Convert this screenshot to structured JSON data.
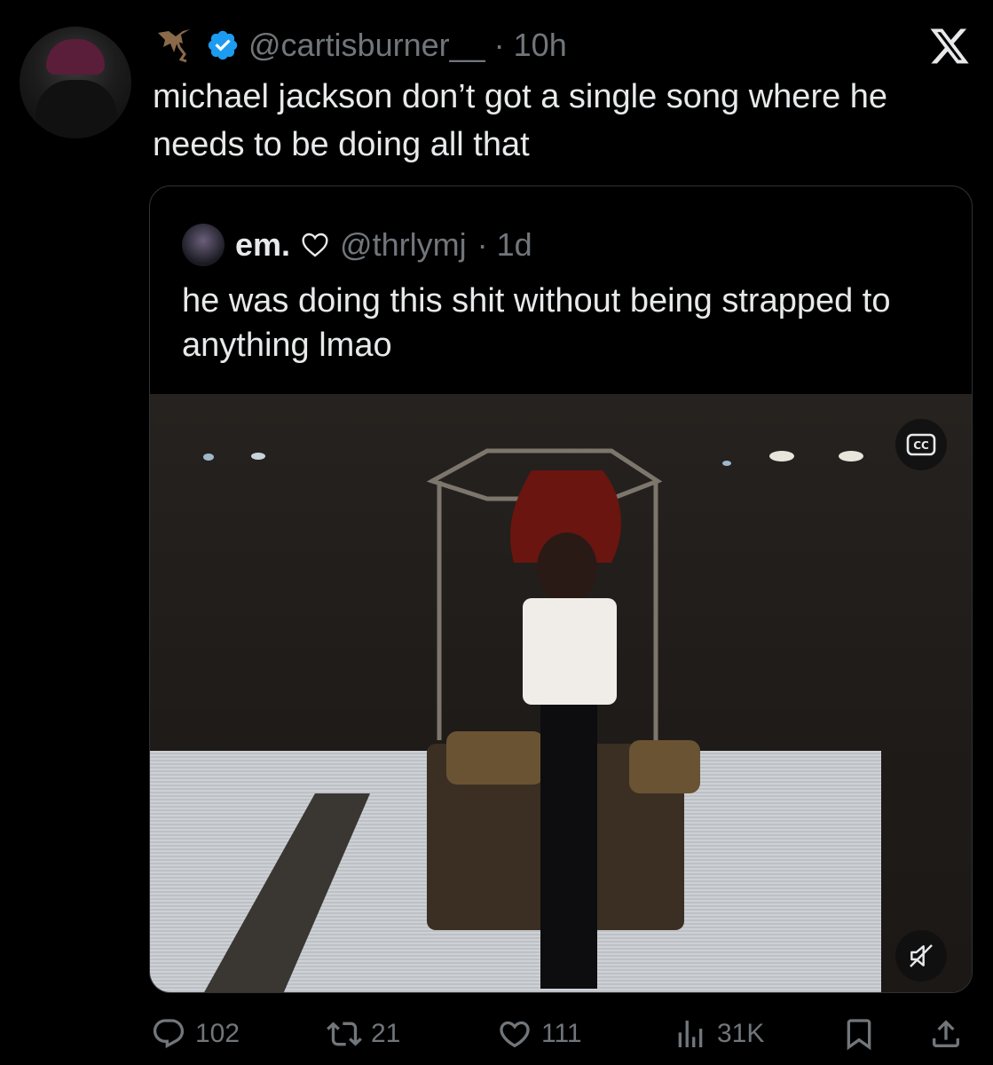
{
  "tweet": {
    "handle": "@cartisburner__",
    "time": "· 10h",
    "text": "michael jackson don’t got a single song where he needs to be doing all that",
    "verified": true
  },
  "quoted": {
    "name": "em.",
    "handle": "@thrlymj",
    "time": "· 1d",
    "text": "he was doing this shit without being strapped to anything lmao"
  },
  "media": {
    "cc_icon": "closed-captions-icon",
    "mute_icon": "muted-speaker-icon"
  },
  "actions": {
    "replies": "102",
    "reposts": "21",
    "likes": "111",
    "views": "31K"
  },
  "colors": {
    "background": "#000000",
    "text": "#e7e9ea",
    "muted": "#71767b",
    "verified": "#1d9bf0",
    "border": "#2f3336"
  }
}
